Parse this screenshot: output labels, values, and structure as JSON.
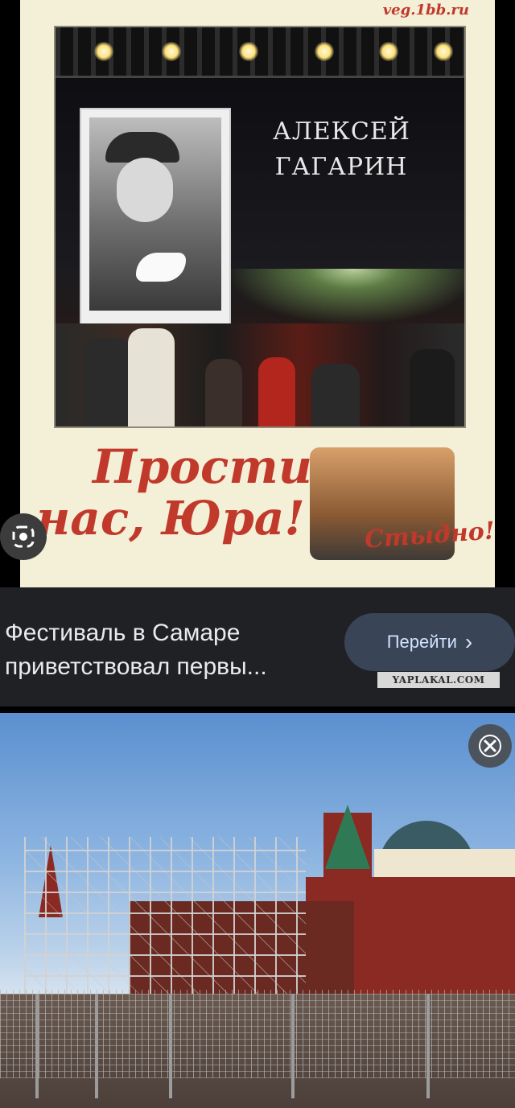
{
  "poster": {
    "watermark": "veg.1bb.ru",
    "screen_name_line1": "АЛЕКСЕЙ",
    "screen_name_line2": "ГАГАРИН",
    "headline_line1": "Прости",
    "headline_line2": "нас, Юра!",
    "sticker_text": "Стыдно!"
  },
  "result": {
    "title": "Фестиваль в Самаре приветствовал первы...",
    "goto_label": "Перейти",
    "goto_chevron": "›",
    "source_badge": "YAPLAKAL.COM"
  },
  "icons": {
    "lens": "lens-icon",
    "close": "close-icon",
    "chevron": "chevron-right-icon"
  },
  "colors": {
    "headline_red": "#c0392b",
    "result_bg": "#202124",
    "button_bg": "#394457",
    "button_text": "#d2e3fc"
  }
}
